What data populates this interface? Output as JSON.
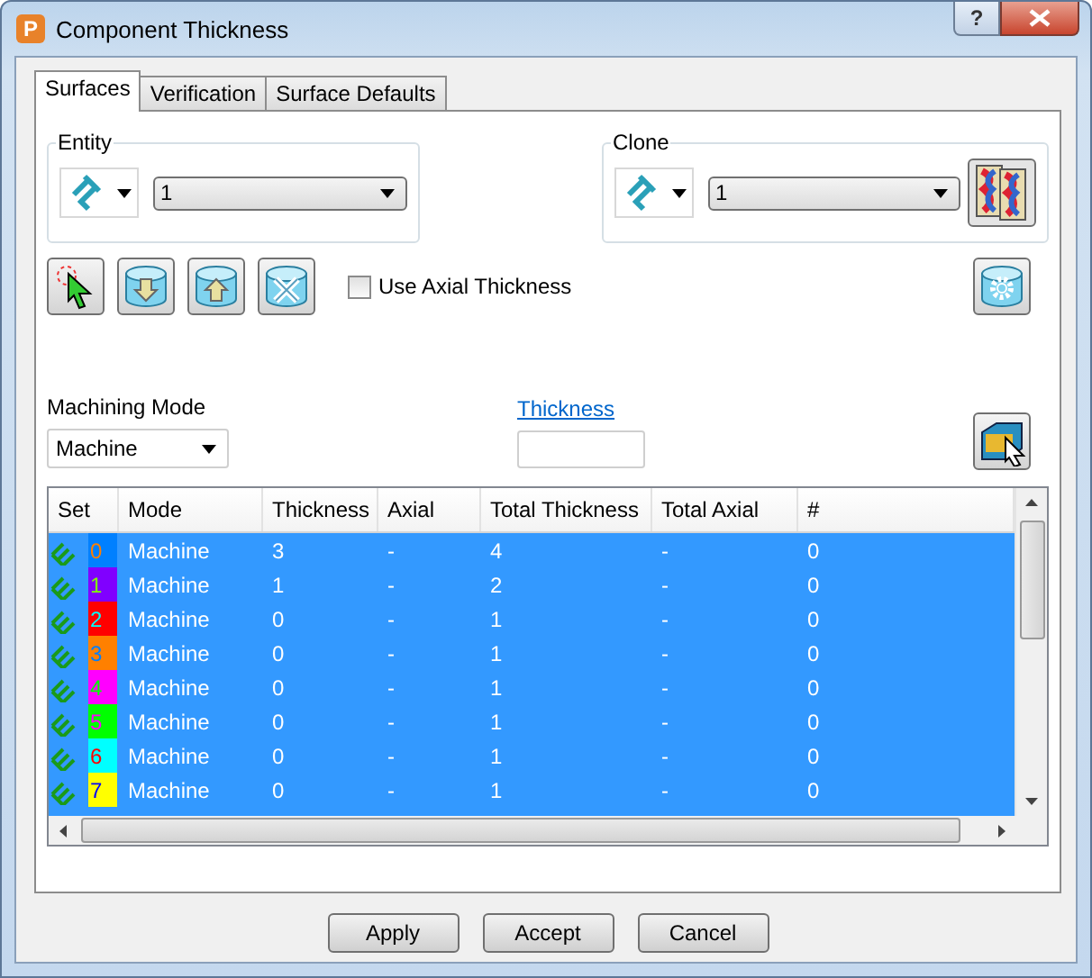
{
  "window": {
    "icon_letter": "P",
    "title": "Component Thickness",
    "help": "?"
  },
  "tabs": [
    {
      "label": "Surfaces",
      "selected": true
    },
    {
      "label": "Verification",
      "selected": false
    },
    {
      "label": "Surface Defaults",
      "selected": false
    }
  ],
  "entity": {
    "legend": "Entity",
    "value": "1"
  },
  "clone": {
    "legend": "Clone",
    "value": "1"
  },
  "use_axial_thickness": {
    "label": "Use Axial Thickness",
    "checked": false
  },
  "machining_mode": {
    "label": "Machining Mode",
    "value": "Machine"
  },
  "thickness": {
    "link": "Thickness"
  },
  "table": {
    "columns": [
      "Set",
      "Mode",
      "Thickness",
      "Axial",
      "Total Thickness",
      "Total Axial",
      "#"
    ],
    "rows": [
      {
        "set": "0",
        "color": "#0080ff",
        "mode": "Machine",
        "thickness": "3",
        "axial": "-",
        "total_thickness": "4",
        "total_axial": "-",
        "count": "0",
        "selected": true
      },
      {
        "set": "1",
        "color": "#8000ff",
        "mode": "Machine",
        "thickness": "1",
        "axial": "-",
        "total_thickness": "2",
        "total_axial": "-",
        "count": "0",
        "selected": true
      },
      {
        "set": "2",
        "color": "#ff0000",
        "mode": "Machine",
        "thickness": "0",
        "axial": "-",
        "total_thickness": "1",
        "total_axial": "-",
        "count": "0",
        "selected": true
      },
      {
        "set": "3",
        "color": "#ff8000",
        "mode": "Machine",
        "thickness": "0",
        "axial": "-",
        "total_thickness": "1",
        "total_axial": "-",
        "count": "0",
        "selected": true
      },
      {
        "set": "4",
        "color": "#ff00ff",
        "mode": "Machine",
        "thickness": "0",
        "axial": "-",
        "total_thickness": "1",
        "total_axial": "-",
        "count": "0",
        "selected": true
      },
      {
        "set": "5",
        "color": "#00ff00",
        "mode": "Machine",
        "thickness": "0",
        "axial": "-",
        "total_thickness": "1",
        "total_axial": "-",
        "count": "0",
        "selected": true
      },
      {
        "set": "6",
        "color": "#00ffff",
        "mode": "Machine",
        "thickness": "0",
        "axial": "-",
        "total_thickness": "1",
        "total_axial": "-",
        "count": "0",
        "selected": true
      },
      {
        "set": "7",
        "color": "#ffff00",
        "mode": "Machine",
        "thickness": "0",
        "axial": "-",
        "total_thickness": "1",
        "total_axial": "-",
        "count": "0",
        "selected": true
      }
    ]
  },
  "buttons": [
    "Apply",
    "Accept",
    "Cancel"
  ]
}
